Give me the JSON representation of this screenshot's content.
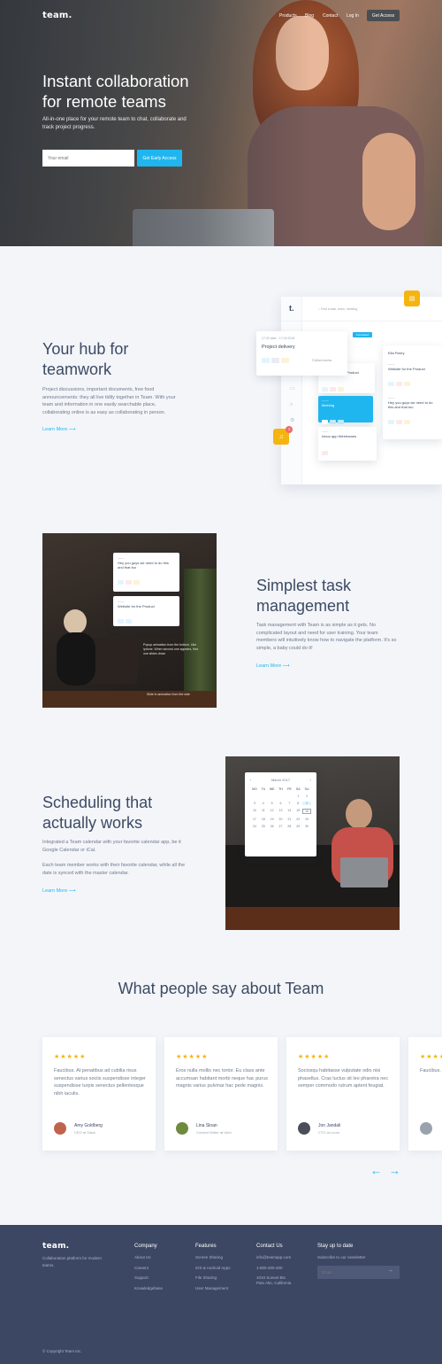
{
  "nav": {
    "logo": "team.",
    "links": [
      "Products",
      "Blog",
      "Contact",
      "Log In"
    ],
    "cta": "Get Access"
  },
  "hero": {
    "title_line1": "Instant collaboration",
    "title_line2": "for remote teams",
    "subtitle": "All-in-one place for your remote team to chat, collaborate and track project progress.",
    "email_placeholder": "Your email",
    "cta": "Get Early Access"
  },
  "hub": {
    "title_line1": "Your hub for",
    "title_line2": "teamwork",
    "body": "Project discussions, important documents, free food announcements: they all live tidily together in Team. With your team and information in one easily searchable place, collaborating online is as easy as collaborating in person.",
    "link": "Learn More",
    "mock": {
      "app_logo": "t.",
      "search": "Find a task, team, meeting",
      "popup_date": "17:00 date · 17.09.2018",
      "popup_title": "Project delivery",
      "popup_file": "Attachments",
      "col_badge": "Completed",
      "col2_title": "Ella Finley",
      "task_a": "Website for the Product",
      "task_b": "Hey you guys we need to do this and that too",
      "task_meeting": "Meeting",
      "task_c": "Inbox app Wireframes",
      "notif_count": "3"
    }
  },
  "tasks": {
    "title_line1": "Simplest task",
    "title_line2": "management",
    "body": "Task management with Team is as simple as it gets. No complicated layout and need for user training. Your team members will intuitively know how to navigate the platform. It's so simple, a baby could do it!",
    "link": "Learn More",
    "card1": "Hey you guys we need to do this and that too",
    "card2": "Website for the Product",
    "caption1": "Popup animation from the bottom. Like iphone. When second one appears, first one slides down",
    "caption2": "Slide in animation from the side"
  },
  "schedule": {
    "title_line1": "Scheduling that",
    "title_line2": "actually works",
    "body1": "Integrated a Team calendar with your favorite calendar app, be it Google Calendar or iCal.",
    "body2": "Each team member works with their favorite calendar, while all the date is synced with the master calendar.",
    "link": "Learn More",
    "calendar": {
      "month": "March 2017",
      "days": [
        "MO",
        "TU",
        "WE",
        "TH",
        "FR",
        "SA",
        "SU"
      ],
      "dates": [
        "",
        "",
        "",
        "",
        "",
        "1",
        "2",
        "3",
        "4",
        "5",
        "6",
        "7",
        "8",
        "9",
        "10",
        "11",
        "12",
        "13",
        "14",
        "15",
        "16",
        "17",
        "18",
        "19",
        "20",
        "21",
        "22",
        "23",
        "24",
        "25",
        "26",
        "27",
        "28",
        "29",
        "30"
      ]
    }
  },
  "testimonials": {
    "title": "What people say about Team",
    "items": [
      {
        "stars": "★★★★★",
        "quote": "Faucibus. At penatibus ad cubilia risus senectus varius sociis suspendisse integer suspendisse turpis senectus pellentesque nibh iaculis.",
        "name": "Amy Goldberg",
        "role": "CEO at Slack"
      },
      {
        "stars": "★★★★★",
        "quote": "Eros nulla mollis nec tortor. Eu class ante accumsan habitant morbi neque hac purus magnis varius pulvinar hac pede magnis.",
        "name": "Lina Sloan",
        "role": "Content Writer at Uber"
      },
      {
        "stars": "★★★★★",
        "quote": "Sociosqu habitasse vulputate odio nisi phasellus. Cras luctus sit leo pharetra nec semper commodo rutrum aptent feugiat.",
        "name": "Jon Jandali",
        "role": "CTO at Loom"
      },
      {
        "stars": "★★★★★",
        "quote": "Faucibus. senectus integer pellentes",
        "name": "",
        "role": ""
      }
    ],
    "prev": "←",
    "next": "→"
  },
  "footer": {
    "logo": "team.",
    "tagline": "Collaboration platform for modern teams.",
    "copyright": "© Copyright Team Inc.",
    "company": {
      "title": "Company",
      "links": [
        "About Us",
        "Careers",
        "Support",
        "Knowledgebase"
      ]
    },
    "features": {
      "title": "Features",
      "links": [
        "Screen Sharing",
        "iOS & Android Apps",
        "File Sharing",
        "User Management"
      ]
    },
    "contact": {
      "title": "Contact Us",
      "links": [
        "info@teamapp.com",
        "1-800-200-300",
        "1010 Sunset Blv.",
        "Palo Alto, California"
      ]
    },
    "newsletter": {
      "title": "Stay up to date",
      "text": "Subscribe to our newsletter",
      "placeholder": "Email",
      "arrow": "→"
    }
  },
  "colors": {
    "accent": "#1fb6ef",
    "footer": "#3c4763",
    "star": "#f5b40f",
    "heading": "#3c4a63"
  }
}
